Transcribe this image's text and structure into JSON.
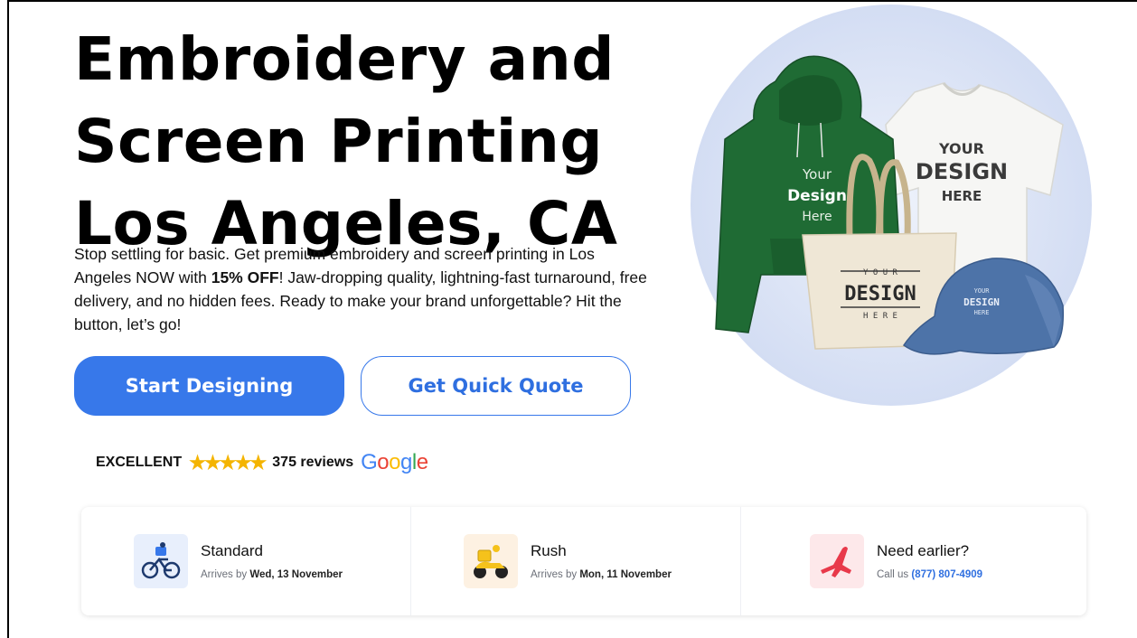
{
  "hero": {
    "title_lines": [
      "Embroidery and",
      "Screen Printing",
      "Los Angeles, CA"
    ],
    "description_part1": "Stop settling for basic. Get premium embroidery and screen printing in Los Angeles NOW with ",
    "description_bold": "15% OFF",
    "description_part2": "! Jaw-dropping quality, lightning-fast turnaround, free delivery, and no hidden fees. Ready to make your brand unforgettable? Hit the button, let’s go!",
    "primary_button": "Start Designing",
    "secondary_button": "Get Quick Quote"
  },
  "image_text": {
    "hoodie_l1": "Your",
    "hoodie_l2": "Design",
    "hoodie_l3": "Here",
    "tshirt_l1": "YOUR",
    "tshirt_l2": "DESIGN",
    "tshirt_l3": "HERE",
    "tote_l1": "Y O U R",
    "tote_l2": "DESIGN",
    "tote_l3": "H E R E",
    "cap_l1": "YOUR",
    "cap_l2": "DESIGN",
    "cap_l3": "HERE"
  },
  "reviews": {
    "rating_label": "EXCELLENT",
    "stars": "★★★★★",
    "count": "375 reviews",
    "brand": [
      "G",
      "o",
      "o",
      "g",
      "l",
      "e"
    ]
  },
  "delivery": [
    {
      "title": "Standard",
      "sub_prefix": "Arrives by ",
      "sub_value": "Wed, 13 November",
      "icon": "bicycle-courier-icon"
    },
    {
      "title": "Rush",
      "sub_prefix": "Arrives by ",
      "sub_value": "Mon, 11 November",
      "icon": "scooter-courier-icon"
    },
    {
      "title": "Need earlier?",
      "sub_prefix": "Call us ",
      "sub_value": "(877) 807-4909",
      "icon": "airplane-icon"
    }
  ],
  "colors": {
    "primary": "#3778ea",
    "star": "#f4b400",
    "circle_bg": "#dbe4f7"
  }
}
